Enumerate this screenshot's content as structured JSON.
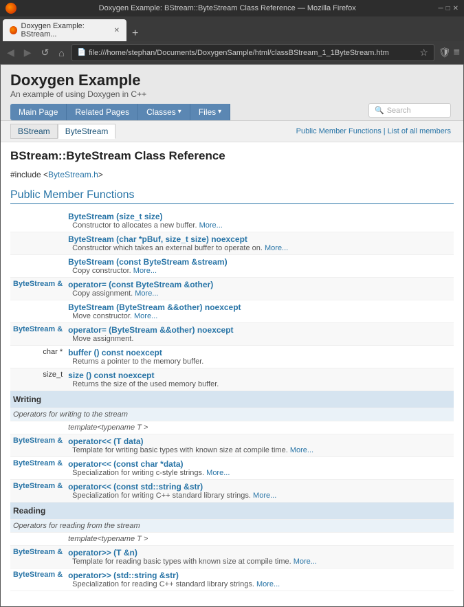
{
  "browser": {
    "title": "Doxygen Example: BStream::ByteStream Class Reference — Mozilla Firefox",
    "tab_label": "Doxygen Example: BStream...",
    "address": "file:///home/stephan/Documents/DoxygenSample/html/classBStream_1_1ByteStream.htm",
    "new_tab_btn": "+",
    "nav_back": "◀",
    "nav_forward": "▶",
    "nav_reload": "↺",
    "nav_home": "⌂"
  },
  "page": {
    "header_title": "Doxygen Example",
    "header_subtitle": "An example of using Doxygen in C++",
    "nav_items": [
      "Main Page",
      "Related Pages",
      "Classes ▾",
      "Files ▾"
    ],
    "search_placeholder": "Search",
    "breadcrumb": [
      "BStream",
      "ByteStream"
    ],
    "quick_links": "Public Member Functions | List of all members",
    "class_title": "BStream::ByteStream Class Reference",
    "include_line": "#include <ByteStream.h>",
    "section_title": "Public Member Functions",
    "members": [
      {
        "return_type": "",
        "func_sig": "ByteStream (size_t size)",
        "description": "Constructor to allocates a new buffer. More...",
        "template": ""
      },
      {
        "return_type": "",
        "func_sig": "ByteStream (char *pBuf, size_t size) noexcept",
        "description": "Constructor which takes an external buffer to operate on. More...",
        "template": ""
      },
      {
        "return_type": "",
        "func_sig": "ByteStream (const ByteStream &stream)",
        "description": "Copy constructor. More...",
        "template": ""
      },
      {
        "return_type": "ByteStream &",
        "func_sig": "operator= (const ByteStream &other)",
        "description": "Copy assignment. More...",
        "template": ""
      },
      {
        "return_type": "",
        "func_sig": "ByteStream (ByteStream &&other) noexcept",
        "description": "Move constructor. More...",
        "template": ""
      },
      {
        "return_type": "ByteStream &",
        "func_sig": "operator= (ByteStream &&other) noexcept",
        "description": "Move assignment.",
        "template": ""
      },
      {
        "return_type": "char *",
        "func_sig": "buffer () const noexcept",
        "description": "Returns a pointer to the memory buffer.",
        "template": ""
      },
      {
        "return_type": "size_t",
        "func_sig": "size () const noexcept",
        "description": "Returns the size of the used memory buffer.",
        "template": ""
      }
    ],
    "writing_section": {
      "title": "Writing",
      "description": "Operators for writing to the stream",
      "members": [
        {
          "template": "template<typename T >",
          "return_type": "ByteStream &",
          "func_sig": "operator<< (T data)",
          "description": "Template for writing basic types with known size at compile time. More..."
        },
        {
          "template": "",
          "return_type": "ByteStream &",
          "func_sig": "operator<< (const char *data)",
          "description": "Specialization for writing c-style strings. More..."
        },
        {
          "template": "",
          "return_type": "ByteStream &",
          "func_sig": "operator<< (const std::string &str)",
          "description": "Specialization for writing C++ standard library strings. More..."
        }
      ]
    },
    "reading_section": {
      "title": "Reading",
      "description": "Operators for reading from the stream",
      "members": [
        {
          "template": "template<typename T >",
          "return_type": "ByteStream &",
          "func_sig": "operator>> (T &n)",
          "description": "Template for reading basic types with known size at compile time. More..."
        },
        {
          "template": "",
          "return_type": "ByteStream &",
          "func_sig": "operator>> (std::string &str)",
          "description": "Specialization for reading C++ standard library strings. More..."
        }
      ]
    }
  }
}
